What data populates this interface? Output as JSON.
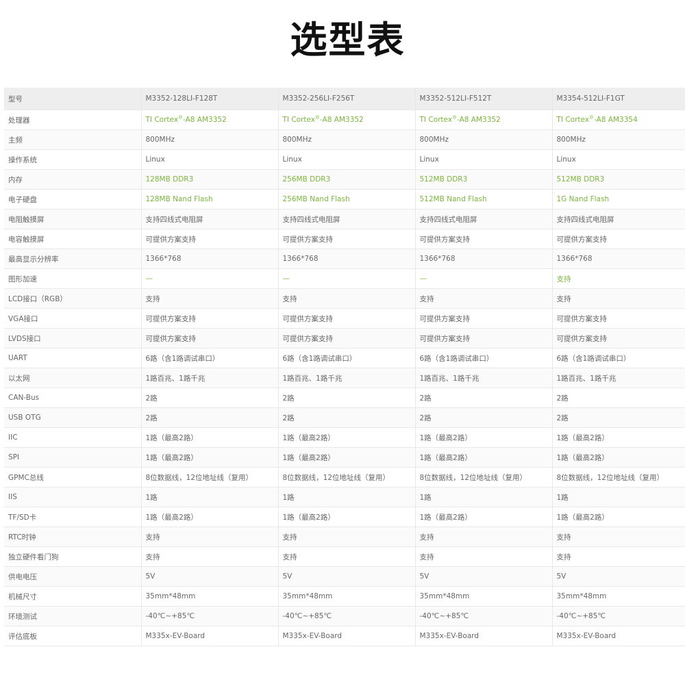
{
  "title": "选型表",
  "highlight_color": "#7bb53c",
  "header": {
    "label": "型号",
    "models": [
      "M3352-128LI-F128T",
      "M3352-256LI-F256T",
      "M3352-512LI-F512T",
      "M3354-512LI-F1GT"
    ]
  },
  "processor": {
    "label": "处理器",
    "prefix": "TI Cortex",
    "reg": "®",
    "values": [
      "-A8 AM3352",
      "-A8 AM3352",
      "-A8 AM3352",
      "-A8 AM3354"
    ]
  },
  "rows": [
    {
      "label": "主频",
      "values": [
        "800MHz",
        "800MHz",
        "800MHz",
        "800MHz"
      ],
      "highlight": [
        false,
        false,
        false,
        false
      ]
    },
    {
      "label": "操作系统",
      "values": [
        "Linux",
        "Linux",
        "Linux",
        "Linux"
      ],
      "highlight": [
        false,
        false,
        false,
        false
      ]
    },
    {
      "label": "内存",
      "values": [
        "128MB DDR3",
        "256MB DDR3",
        "512MB DDR3",
        "512MB DDR3"
      ],
      "highlight": [
        true,
        true,
        true,
        true
      ]
    },
    {
      "label": "电子硬盘",
      "values": [
        "128MB Nand Flash",
        "256MB Nand Flash",
        "512MB Nand Flash",
        "1G Nand Flash"
      ],
      "highlight": [
        true,
        true,
        true,
        true
      ]
    },
    {
      "label": "电阻触摸屏",
      "values": [
        "支持四线式电阻屏",
        "支持四线式电阻屏",
        "支持四线式电阻屏",
        "支持四线式电阻屏"
      ],
      "highlight": [
        false,
        false,
        false,
        false
      ]
    },
    {
      "label": "电容触摸屏",
      "values": [
        "可提供方案支持",
        "可提供方案支持",
        "可提供方案支持",
        "可提供方案支持"
      ],
      "highlight": [
        false,
        false,
        false,
        false
      ]
    },
    {
      "label": "最高显示分辨率",
      "values": [
        "1366*768",
        "1366*768",
        "1366*768",
        "1366*768"
      ],
      "highlight": [
        false,
        false,
        false,
        false
      ]
    },
    {
      "label": "图形加速",
      "values": [
        "—",
        "—",
        "—",
        "支持"
      ],
      "highlight": [
        true,
        true,
        true,
        true
      ]
    },
    {
      "label": "LCD接口（RGB）",
      "values": [
        "支持",
        "支持",
        "支持",
        "支持"
      ],
      "highlight": [
        false,
        false,
        false,
        false
      ]
    },
    {
      "label": "VGA接口",
      "values": [
        "可提供方案支持",
        "可提供方案支持",
        "可提供方案支持",
        "可提供方案支持"
      ],
      "highlight": [
        false,
        false,
        false,
        false
      ]
    },
    {
      "label": "LVDS接口",
      "values": [
        "可提供方案支持",
        "可提供方案支持",
        "可提供方案支持",
        "可提供方案支持"
      ],
      "highlight": [
        false,
        false,
        false,
        false
      ]
    },
    {
      "label": "UART",
      "values": [
        "6路（含1路调试串口）",
        "6路（含1路调试串口）",
        "6路（含1路调试串口）",
        "6路（含1路调试串口）"
      ],
      "highlight": [
        false,
        false,
        false,
        false
      ]
    },
    {
      "label": "以太网",
      "values": [
        "1路百兆、1路千兆",
        "1路百兆、1路千兆",
        "1路百兆、1路千兆",
        "1路百兆、1路千兆"
      ],
      "highlight": [
        false,
        false,
        false,
        false
      ]
    },
    {
      "label": "CAN-Bus",
      "values": [
        "2路",
        "2路",
        "2路",
        "2路"
      ],
      "highlight": [
        false,
        false,
        false,
        false
      ]
    },
    {
      "label": "USB OTG",
      "values": [
        "2路",
        "2路",
        "2路",
        "2路"
      ],
      "highlight": [
        false,
        false,
        false,
        false
      ]
    },
    {
      "label": "IIC",
      "values": [
        "1路（最高2路）",
        "1路（最高2路）",
        "1路（最高2路）",
        "1路（最高2路）"
      ],
      "highlight": [
        false,
        false,
        false,
        false
      ]
    },
    {
      "label": "SPI",
      "values": [
        "1路（最高2路）",
        "1路（最高2路）",
        "1路（最高2路）",
        "1路（最高2路）"
      ],
      "highlight": [
        false,
        false,
        false,
        false
      ]
    },
    {
      "label": "GPMC总线",
      "values": [
        "8位数据线，12位地址线（复用）",
        "8位数据线，12位地址线（复用）",
        "8位数据线，12位地址线（复用）",
        "8位数据线，12位地址线（复用）"
      ],
      "highlight": [
        false,
        false,
        false,
        false
      ]
    },
    {
      "label": "IIS",
      "values": [
        "1路",
        "1路",
        "1路",
        "1路"
      ],
      "highlight": [
        false,
        false,
        false,
        false
      ]
    },
    {
      "label": "TF/SD卡",
      "values": [
        "1路（最高2路）",
        "1路（最高2路）",
        "1路（最高2路）",
        "1路（最高2路）"
      ],
      "highlight": [
        false,
        false,
        false,
        false
      ]
    },
    {
      "label": "RTC时钟",
      "values": [
        "支持",
        "支持",
        "支持",
        "支持"
      ],
      "highlight": [
        false,
        false,
        false,
        false
      ]
    },
    {
      "label": "独立硬件看门狗",
      "values": [
        "支持",
        "支持",
        "支持",
        "支持"
      ],
      "highlight": [
        false,
        false,
        false,
        false
      ]
    },
    {
      "label": "供电电压",
      "values": [
        "5V",
        "5V",
        "5V",
        "5V"
      ],
      "highlight": [
        false,
        false,
        false,
        false
      ]
    },
    {
      "label": "机械尺寸",
      "values": [
        "35mm*48mm",
        "35mm*48mm",
        "35mm*48mm",
        "35mm*48mm"
      ],
      "highlight": [
        false,
        false,
        false,
        false
      ]
    },
    {
      "label": "环境测试",
      "values": [
        "-40℃~+85℃",
        "-40℃~+85℃",
        "-40℃~+85℃",
        "-40℃~+85℃"
      ],
      "highlight": [
        false,
        false,
        false,
        false
      ]
    },
    {
      "label": "评估底板",
      "values": [
        "M335x-EV-Board",
        "M335x-EV-Board",
        "M335x-EV-Board",
        "M335x-EV-Board"
      ],
      "highlight": [
        false,
        false,
        false,
        false
      ]
    }
  ]
}
